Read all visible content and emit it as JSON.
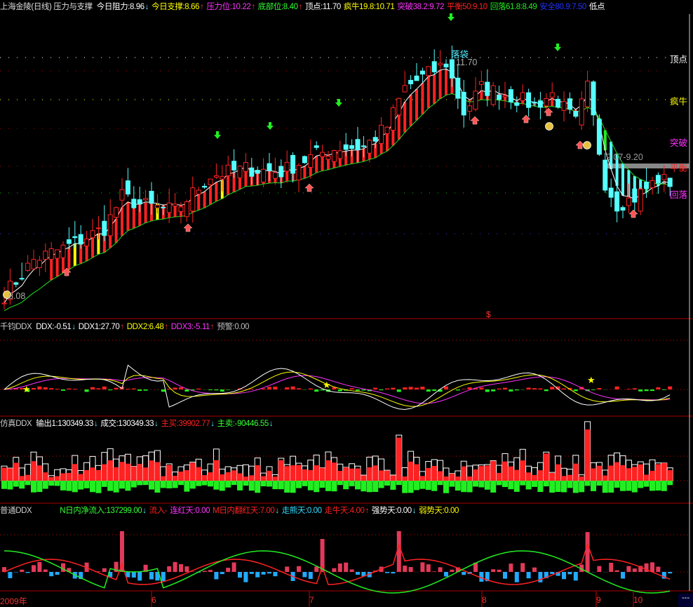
{
  "main_header": {
    "title": "上海金陵(日线) 压力与支撑",
    "items": [
      {
        "label": "今日阻力:8.96",
        "arrow": "↓",
        "color": "#ffffff"
      },
      {
        "label": "今日支撑:8.66",
        "arrow": "↑",
        "color": "#ffff00"
      },
      {
        "label": "压力位:10.22",
        "arrow": "↑",
        "color": "#ff33ff"
      },
      {
        "label": "底部位:8.40",
        "arrow": "↑",
        "color": "#33ff33"
      },
      {
        "label": "顶点:11.70",
        "arrow": "",
        "color": "#ffffff"
      },
      {
        "label": "疯牛19.8:10.71",
        "arrow": "",
        "color": "#ffff00"
      },
      {
        "label": "突破38.2:9.72",
        "arrow": "",
        "color": "#ff33ff"
      },
      {
        "label": "平衡50:9.10",
        "arrow": "",
        "color": "#ff2222"
      },
      {
        "label": "回落61.8:8.49",
        "arrow": "",
        "color": "#22ee22"
      },
      {
        "label": "安全80.9:7.50",
        "arrow": "",
        "color": "#2233ff"
      },
      {
        "label": "低点",
        "arrow": "",
        "color": "#ffffff"
      }
    ]
  },
  "right_labels": [
    {
      "label": "顶点",
      "color": "#ffffff"
    },
    {
      "label": "疯牛",
      "color": "#ffff00"
    },
    {
      "label": "突破",
      "color": "#ff33ff"
    },
    {
      "label": "平衡",
      "color": "#ff2222"
    },
    {
      "label": "回落",
      "color": "#ff33ff"
    }
  ],
  "annotations": {
    "top_label": "落袋",
    "top_price": "11.70",
    "low_price": "8.08",
    "band_label": "9.07-9.20",
    "marker": "$"
  },
  "ddx_header": {
    "title": "千钧DDX",
    "items": [
      {
        "label": "DDX:-0.51",
        "arrow": "↓",
        "color": "#ffffff"
      },
      {
        "label": "DDX1:27.70",
        "arrow": "↑",
        "color": "#ffffff"
      },
      {
        "label": "DDX2:6.48",
        "arrow": "↑",
        "color": "#ffff00"
      },
      {
        "label": "DDX3:-5.11",
        "arrow": "↑",
        "color": "#ff33ff"
      },
      {
        "label": "预警:0.00",
        "arrow": "",
        "color": "#bbbbbb"
      }
    ]
  },
  "sim_header": {
    "title": "仿真DDX",
    "items": [
      {
        "label": "输出1:130349.33",
        "arrow": "↓",
        "color": "#ffffff"
      },
      {
        "label": "成交:130349.33",
        "arrow": "↓",
        "color": "#ffffff"
      },
      {
        "label": "主买:39902.77",
        "arrow": "↓",
        "color": "#ff2222"
      },
      {
        "label": "主卖:-90446.55",
        "arrow": "↓",
        "color": "#33ff33"
      }
    ]
  },
  "common_header": {
    "title": "普通DDX",
    "items": [
      {
        "label": "N日内净流入:137299.00",
        "arrow": "↓",
        "color": "#33ff33"
      },
      {
        "label": "流入-",
        "arrow": "",
        "color": "#ff2222"
      },
      {
        "label": "连红天:0.00",
        "arrow": "",
        "color": "#ff33ff"
      },
      {
        "label": "M日内翻红天:7.00",
        "arrow": "↓",
        "color": "#ff2222"
      },
      {
        "label": "走熊天:0.00",
        "arrow": "",
        "color": "#33ddff"
      },
      {
        "label": "走牛天:4.00",
        "arrow": "↑",
        "color": "#ff2222"
      },
      {
        "label": "强势天:0.00",
        "arrow": "↓",
        "color": "#ffffff"
      },
      {
        "label": "弱势天:0.00",
        "arrow": "",
        "color": "#ffff00"
      }
    ]
  },
  "time_axis": {
    "labels": [
      "2009年",
      "6",
      "7",
      "8",
      "9",
      "10"
    ],
    "corner": "---"
  },
  "chart_data": {
    "type": "candlestick",
    "title": "上海金陵(日线)",
    "bars": 114,
    "close_path": [
      [
        0,
        8.1
      ],
      [
        5,
        8.64
      ],
      [
        11,
        8.86
      ],
      [
        17,
        9.13
      ],
      [
        20,
        9.62
      ],
      [
        23,
        9.5
      ],
      [
        29,
        9.4
      ],
      [
        35,
        9.94
      ],
      [
        41,
        10.05
      ],
      [
        47,
        10.0
      ],
      [
        53,
        10.27
      ],
      [
        57,
        10.38
      ],
      [
        61,
        10.38
      ],
      [
        65,
        10.7
      ],
      [
        68,
        11.3
      ],
      [
        73,
        11.57
      ],
      [
        75,
        11.68
      ],
      [
        78,
        10.92
      ],
      [
        81,
        11.3
      ],
      [
        85,
        11.2
      ],
      [
        90,
        11.03
      ],
      [
        93,
        11.2
      ],
      [
        97,
        10.76
      ],
      [
        99,
        11.3
      ],
      [
        102,
        9.84
      ],
      [
        104,
        9.5
      ],
      [
        107,
        9.6
      ],
      [
        111,
        9.89
      ],
      [
        113,
        9.84
      ]
    ],
    "levels": {
      "顶点": 11.7,
      "疯牛": 10.71,
      "突破": 9.72,
      "平衡": 9.1,
      "回落": 8.49,
      "安全": 7.5
    },
    "high": 11.7,
    "low": 8.08,
    "colors": {
      "up": "#ff2222",
      "down": "#55ffff",
      "ma_fast": "#ffffff",
      "ma_slow": "#22dd22"
    }
  }
}
